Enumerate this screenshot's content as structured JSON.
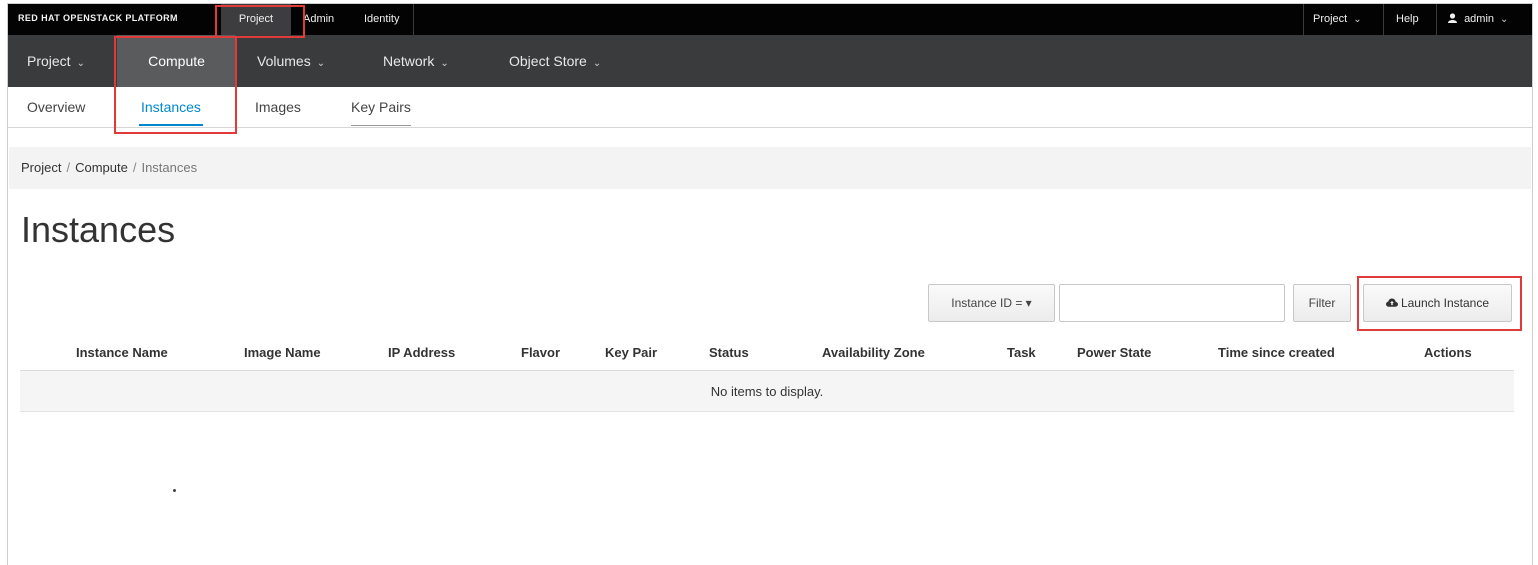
{
  "masthead": {
    "brand": "RED HAT OPENSTACK PLATFORM",
    "nav": [
      {
        "label": "Project",
        "active": true
      },
      {
        "label": "Admin",
        "active": false
      },
      {
        "label": "Identity",
        "active": false
      }
    ],
    "project_menu": "Project",
    "help": "Help",
    "user": "admin"
  },
  "subnav": {
    "items": [
      {
        "label": "Project",
        "dropdown": true
      },
      {
        "label": "Compute",
        "dropdown": false,
        "active": true
      },
      {
        "label": "Volumes",
        "dropdown": true
      },
      {
        "label": "Network",
        "dropdown": true
      },
      {
        "label": "Object Store",
        "dropdown": true
      }
    ]
  },
  "tabs": [
    {
      "label": "Overview"
    },
    {
      "label": "Instances",
      "active": true
    },
    {
      "label": "Images"
    },
    {
      "label": "Key Pairs"
    }
  ],
  "breadcrumb": [
    "Project",
    "Compute",
    "Instances"
  ],
  "page_title": "Instances",
  "toolbar": {
    "filter_field": "Instance ID = ▾",
    "filter_value": "",
    "filter_button": "Filter",
    "launch_button": "Launch Instance"
  },
  "table": {
    "columns": [
      "Instance Name",
      "Image Name",
      "IP Address",
      "Flavor",
      "Key Pair",
      "Status",
      "Availability Zone",
      "Task",
      "Power State",
      "Time since created",
      "Actions"
    ],
    "empty_message": "No items to display."
  },
  "colors": {
    "masthead_bg": "#030303",
    "subnav_bg": "#3a3b3d",
    "accent": "#0088ce",
    "highlight": "#e03a3a"
  }
}
